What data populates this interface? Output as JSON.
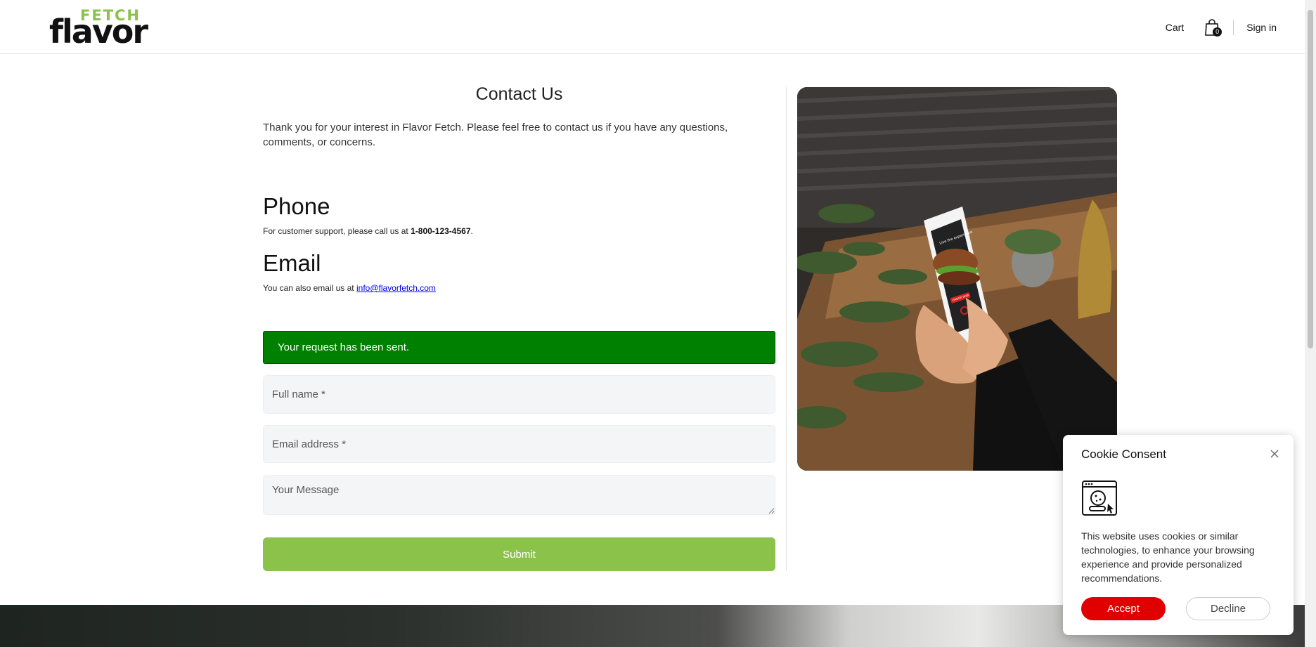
{
  "header": {
    "logo_top": "FETCH",
    "logo_bottom": "flavor",
    "cart_label": "Cart",
    "cart_count": "0",
    "signin_label": "Sign in"
  },
  "contact": {
    "title": "Contact Us",
    "intro": "Thank you for your interest in Flavor Fetch. Please feel free to contact us if you have any questions, comments, or concerns.",
    "phone_heading": "Phone",
    "phone_text": "For customer support, please call us at ",
    "phone_number": "1-800-123-4567",
    "phone_suffix": ".",
    "email_heading": "Email",
    "email_text": "You can also email us at ",
    "email_address": "info@flavorfetch.com"
  },
  "form": {
    "alert": "Your request has been sent.",
    "name_placeholder": "Full name *",
    "email_placeholder": "Email address *",
    "message_placeholder": "Your Message",
    "submit_label": "Submit"
  },
  "photo": {
    "phone_screen_caption": "Live the experience",
    "phone_screen_button": "ORDER NOW"
  },
  "cookie": {
    "title": "Cookie Consent",
    "text": "This website uses cookies or similar technologies, to enhance your browsing experience and provide personalized recommendations.",
    "accept_label": "Accept",
    "decline_label": "Decline"
  },
  "colors": {
    "brand_green": "#8bc34a",
    "alert_green": "#008000",
    "accept_red": "#e00000"
  }
}
